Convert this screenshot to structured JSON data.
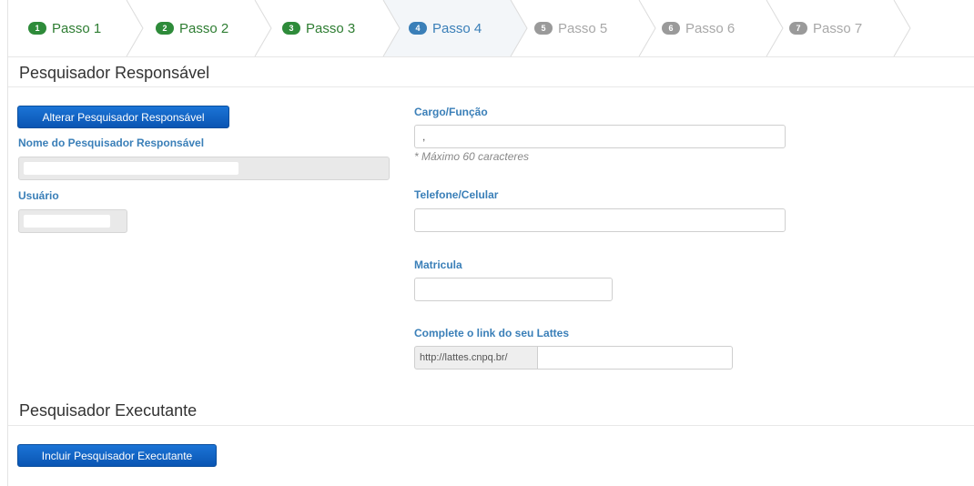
{
  "steps": [
    {
      "num": "1",
      "label": "Passo 1",
      "state": "done"
    },
    {
      "num": "2",
      "label": "Passo 2",
      "state": "done"
    },
    {
      "num": "3",
      "label": "Passo 3",
      "state": "done"
    },
    {
      "num": "4",
      "label": "Passo 4",
      "state": "active"
    },
    {
      "num": "5",
      "label": "Passo 5",
      "state": "todo"
    },
    {
      "num": "6",
      "label": "Passo 6",
      "state": "todo"
    },
    {
      "num": "7",
      "label": "Passo 7",
      "state": "todo"
    }
  ],
  "colors": {
    "done": "#2e8b3a",
    "active": "#3a7fb8",
    "todo": "#9a9a9a",
    "active_bg": "#f3f6f9",
    "button": "#0a55b3"
  },
  "responsavel": {
    "title": "Pesquisador Responsável",
    "change_button": "Alterar Pesquisador Responsável",
    "name_label": "Nome do Pesquisador Responsável",
    "user_label": "Usuário",
    "cargo_label": "Cargo/Função",
    "cargo_value": ",",
    "cargo_hint": "* Máximo 60 caracteres",
    "phone_label": "Telefone/Celular",
    "phone_value": "",
    "matricula_label": "Matricula",
    "matricula_value": "",
    "lattes_label": "Complete o link do seu Lattes",
    "lattes_prefix": "http://lattes.cnpq.br/",
    "lattes_value": ""
  },
  "executante": {
    "title": "Pesquisador Executante",
    "add_button": "Incluir Pesquisador Executante"
  }
}
